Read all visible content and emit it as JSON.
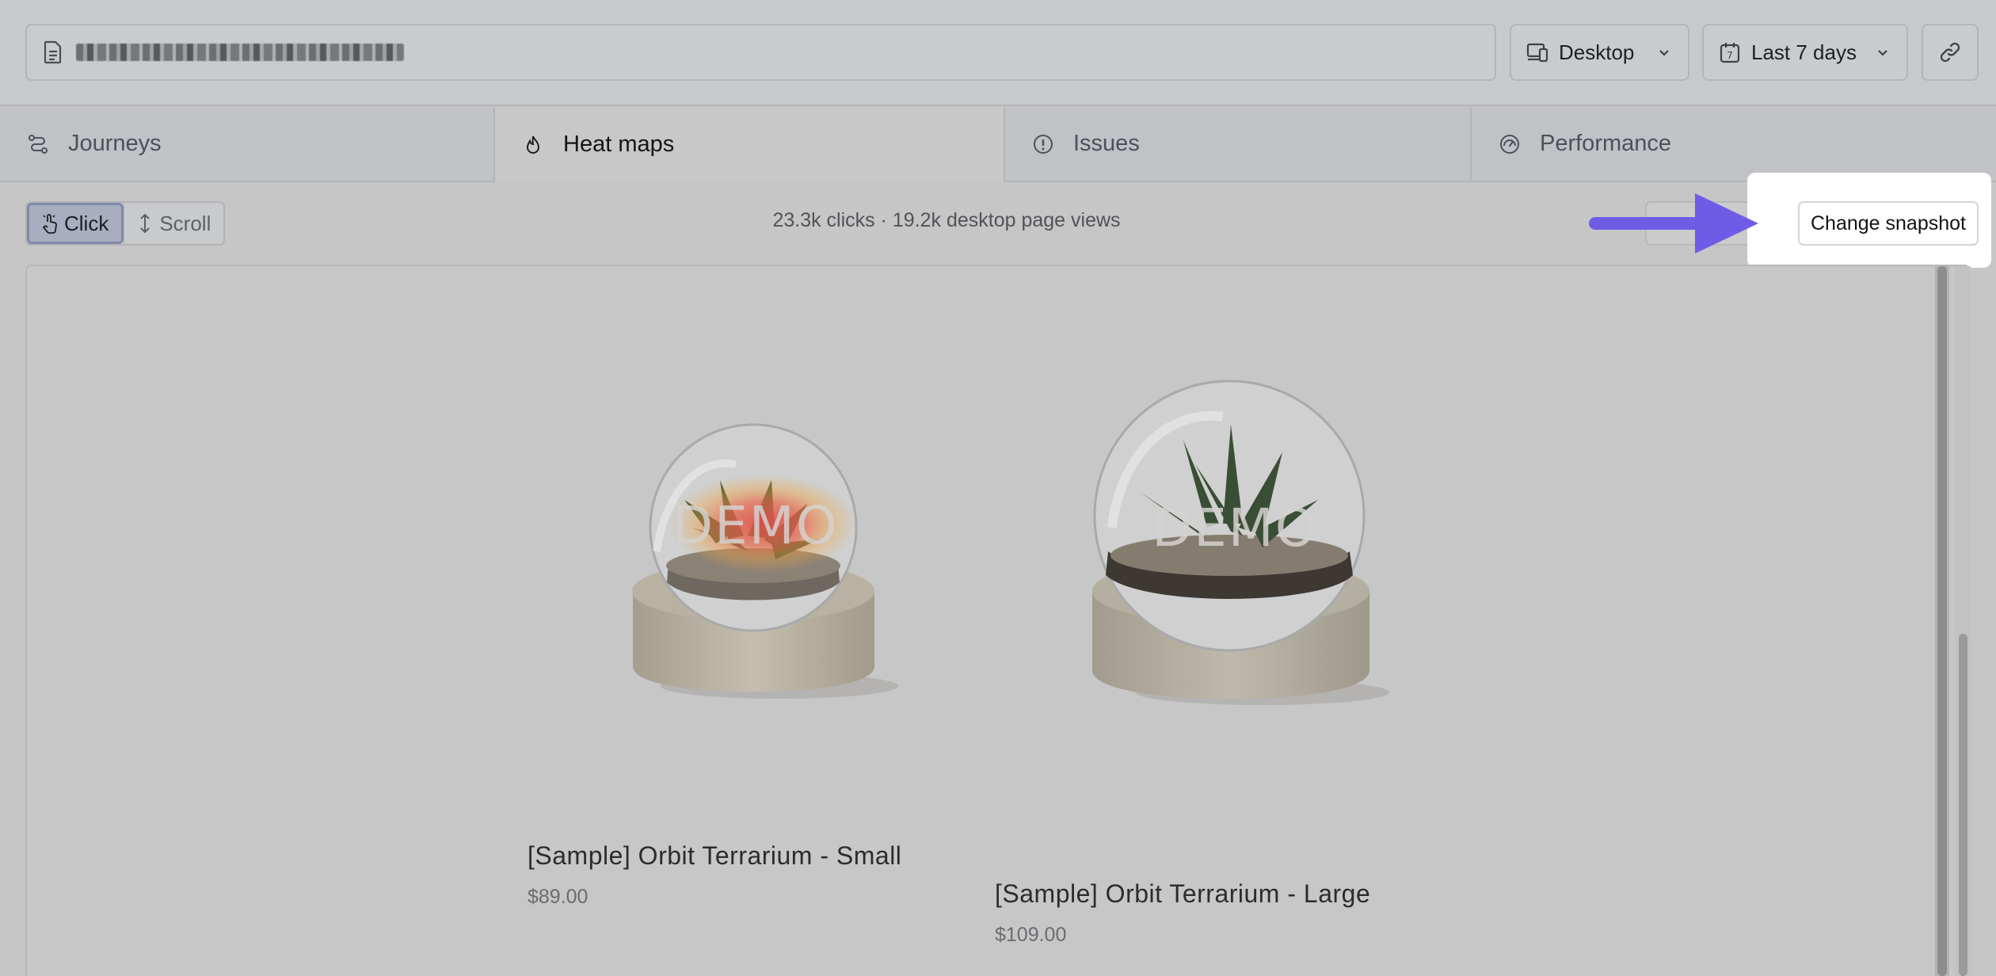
{
  "header": {
    "url_text": "",
    "device_select": {
      "value": "Desktop",
      "icon": "devices-icon"
    },
    "range_select": {
      "value": "Last 7 days",
      "icon": "calendar-icon",
      "calendar_day": "7"
    },
    "share_link_icon": "link-icon"
  },
  "tabs": [
    {
      "label": "Journeys",
      "icon": "journeys-icon",
      "active": false
    },
    {
      "label": "Heat maps",
      "icon": "flame-icon",
      "active": true
    },
    {
      "label": "Issues",
      "icon": "alert-circle-icon",
      "active": false
    },
    {
      "label": "Performance",
      "icon": "gauge-icon",
      "active": false
    }
  ],
  "toolbar": {
    "mode_click": "Click",
    "mode_scroll": "Scroll",
    "stats": "23.3k clicks · 19.2k desktop page views",
    "change_snapshot": "Change snapshot"
  },
  "annotation": {
    "arrow_color": "#6f5ce6"
  },
  "preview": {
    "watermark": "DEMO",
    "products": [
      {
        "title": "[Sample] Orbit Terrarium - Small",
        "price": "$89.00"
      },
      {
        "title": "[Sample] Orbit Terrarium - Large",
        "price": "$109.00"
      }
    ]
  },
  "colors": {
    "overlay_bg": "#c6c6c6",
    "active_toggle": "#a8adbf",
    "heat_hotspot": "#e0504a",
    "highlight_bg": "#ffffff"
  }
}
